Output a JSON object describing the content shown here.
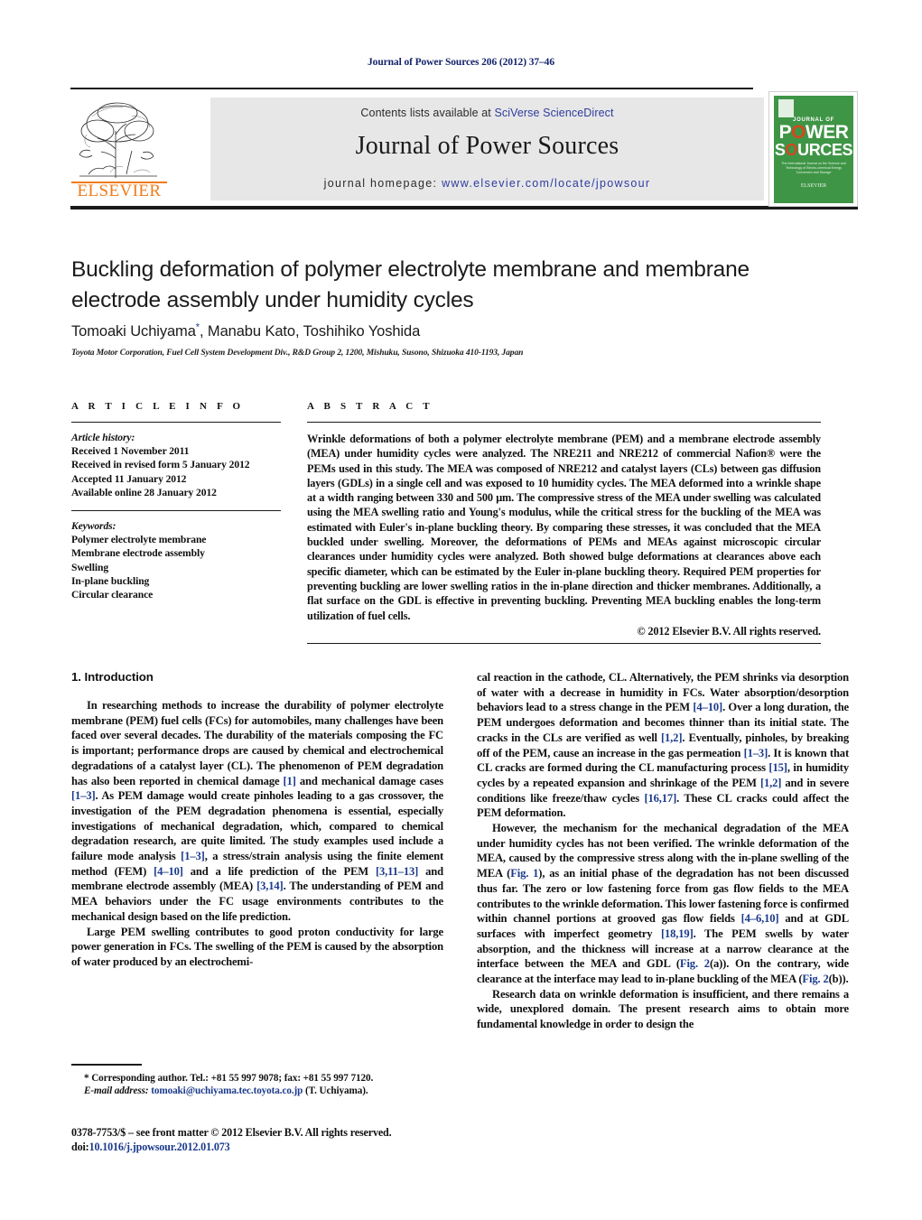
{
  "running_head": "Journal of Power Sources 206 (2012) 37–46",
  "masthead": {
    "contents_prefix": "Contents lists available at ",
    "sciencedirect_link": "SciVerse ScienceDirect",
    "journal_title": "Journal of Power Sources",
    "homepage_prefix": "journal homepage: ",
    "homepage_url": "www.elsevier.com/locate/jpowsour",
    "publisher_wordmark": "ELSEVIER",
    "publisher_accent_color": "#ef7c1b",
    "link_color": "#2f3c9e",
    "band_color": "#e7e7e8"
  },
  "cover": {
    "line1": "JOURNAL OF",
    "line2": "POWER",
    "line3": "SOURCES",
    "tagline": "The International Journal on the Science and Technology of Electro‐chemical Energy Conversion and Storage",
    "bottom_logo": "ELSEVIER",
    "background_color": "#3f9546",
    "accent_color": "#d4481f"
  },
  "article": {
    "title": "Buckling deformation of polymer electrolyte membrane and membrane electrode assembly under humidity cycles",
    "authors": "Tomoaki Uchiyama*, Manabu Kato, Toshihiko Yoshida",
    "authors_plain": "Tomoaki Uchiyama, Manabu Kato, Toshihiko Yoshida",
    "corresponding_marker": "*",
    "affiliation": "Toyota Motor Corporation, Fuel Cell System Development Div., R&D Group 2, 1200, Mishuku, Susono, Shizuoka 410-1193, Japan"
  },
  "info": {
    "heading": "A R T I C L E   I N F O",
    "history_label": "Article history:",
    "history": [
      "Received 1 November 2011",
      "Received in revised form 5 January 2012",
      "Accepted 11 January 2012",
      "Available online 28 January 2012"
    ],
    "keywords_label": "Keywords:",
    "keywords": [
      "Polymer electrolyte membrane",
      "Membrane electrode assembly",
      "Swelling",
      "In-plane buckling",
      "Circular clearance"
    ]
  },
  "abstract": {
    "heading": "A B S T R A C T",
    "text": "Wrinkle deformations of both a polymer electrolyte membrane (PEM) and a membrane electrode assembly (MEA) under humidity cycles were analyzed. The NRE211 and NRE212 of commercial Nafion® were the PEMs used in this study. The MEA was composed of NRE212 and catalyst layers (CLs) between gas diffusion layers (GDLs) in a single cell and was exposed to 10 humidity cycles. The MEA deformed into a wrinkle shape at a width ranging between 330 and 500 μm. The compressive stress of the MEA under swelling was calculated using the MEA swelling ratio and Young's modulus, while the critical stress for the buckling of the MEA was estimated with Euler's in-plane buckling theory. By comparing these stresses, it was concluded that the MEA buckled under swelling. Moreover, the deformations of PEMs and MEAs against microscopic circular clearances under humidity cycles were analyzed. Both showed bulge deformations at clearances above each specific diameter, which can be estimated by the Euler in-plane buckling theory. Required PEM properties for preventing buckling are lower swelling ratios in the in-plane direction and thicker membranes. Additionally, a flat surface on the GDL is effective in preventing buckling. Preventing MEA buckling enables the long-term utilization of fuel cells.",
    "copyright": "© 2012 Elsevier B.V. All rights reserved."
  },
  "body": {
    "section_number_title": "1.  Introduction",
    "left_paragraphs": [
      "In researching methods to increase the durability of polymer electrolyte membrane (PEM) fuel cells (FCs) for automobiles, many challenges have been faced over several decades. The durability of the materials composing the FC is important; performance drops are caused by chemical and electrochemical degradations of a catalyst layer (CL). The phenomenon of PEM degradation has also been reported in chemical damage [1] and mechanical damage cases [1–3]. As PEM damage would create pinholes leading to a gas crossover, the investigation of the PEM degradation phenomena is essential, especially investigations of mechanical degradation, which, compared to chemical degradation research, are quite limited. The study examples used include a failure mode analysis [1–3], a stress/strain analysis using the finite element method (FEM) [4–10] and a life prediction of the PEM [3,11–13] and membrane electrode assembly (MEA) [3,14]. The understanding of PEM and MEA behaviors under the FC usage environments contributes to the mechanical design based on the life prediction.",
      "Large PEM swelling contributes to good proton conductivity for large power generation in FCs. The swelling of the PEM is caused by the absorption of water produced by an electrochemi-"
    ],
    "right_paragraphs": [
      "cal reaction in the cathode, CL. Alternatively, the PEM shrinks via desorption of water with a decrease in humidity in FCs. Water absorption/desorption behaviors lead to a stress change in the PEM [4–10]. Over a long duration, the PEM undergoes deformation and becomes thinner than its initial state. The cracks in the CLs are verified as well [1,2]. Eventually, pinholes, by breaking off of the PEM, cause an increase in the gas permeation [1–3]. It is known that CL cracks are formed during the CL manufacturing process [15], in humidity cycles by a repeated expansion and shrinkage of the PEM [1,2] and in severe conditions like freeze/thaw cycles [16,17]. These CL cracks could affect the PEM deformation.",
      "However, the mechanism for the mechanical degradation of the MEA under humidity cycles has not been verified. The wrinkle deformation of the MEA, caused by the compressive stress along with the in-plane swelling of the MEA (Fig. 1), as an initial phase of the degradation has not been discussed thus far. The zero or low fastening force from gas flow fields to the MEA contributes to the wrinkle deformation. This lower fastening force is confirmed within channel portions at grooved gas flow fields [4–6,10] and at GDL surfaces with imperfect geometry [18,19]. The PEM swells by water absorption, and the thickness will increase at a narrow clearance at the interface between the MEA and GDL (Fig. 2(a)). On the contrary, wide clearance at the interface may lead to in-plane buckling of the MEA (Fig. 2(b)).",
      "Research data on wrinkle deformation is insufficient, and there remains a wide, unexplored domain. The present research aims to obtain more fundamental knowledge in order to design the"
    ]
  },
  "footnote": {
    "corresponding": "* Corresponding author. Tel.: +81 55 997 9078; fax: +81 55 997 7120.",
    "email_label": "E-mail address:",
    "email": "tomoaki@uchiyama.tec.toyota.co.jp",
    "email_owner": "(T. Uchiyama)."
  },
  "footer": {
    "issn_line": "0378-7753/$ – see front matter © 2012 Elsevier B.V. All rights reserved.",
    "doi_prefix": "doi:",
    "doi": "10.1016/j.jpowsour.2012.01.073"
  }
}
